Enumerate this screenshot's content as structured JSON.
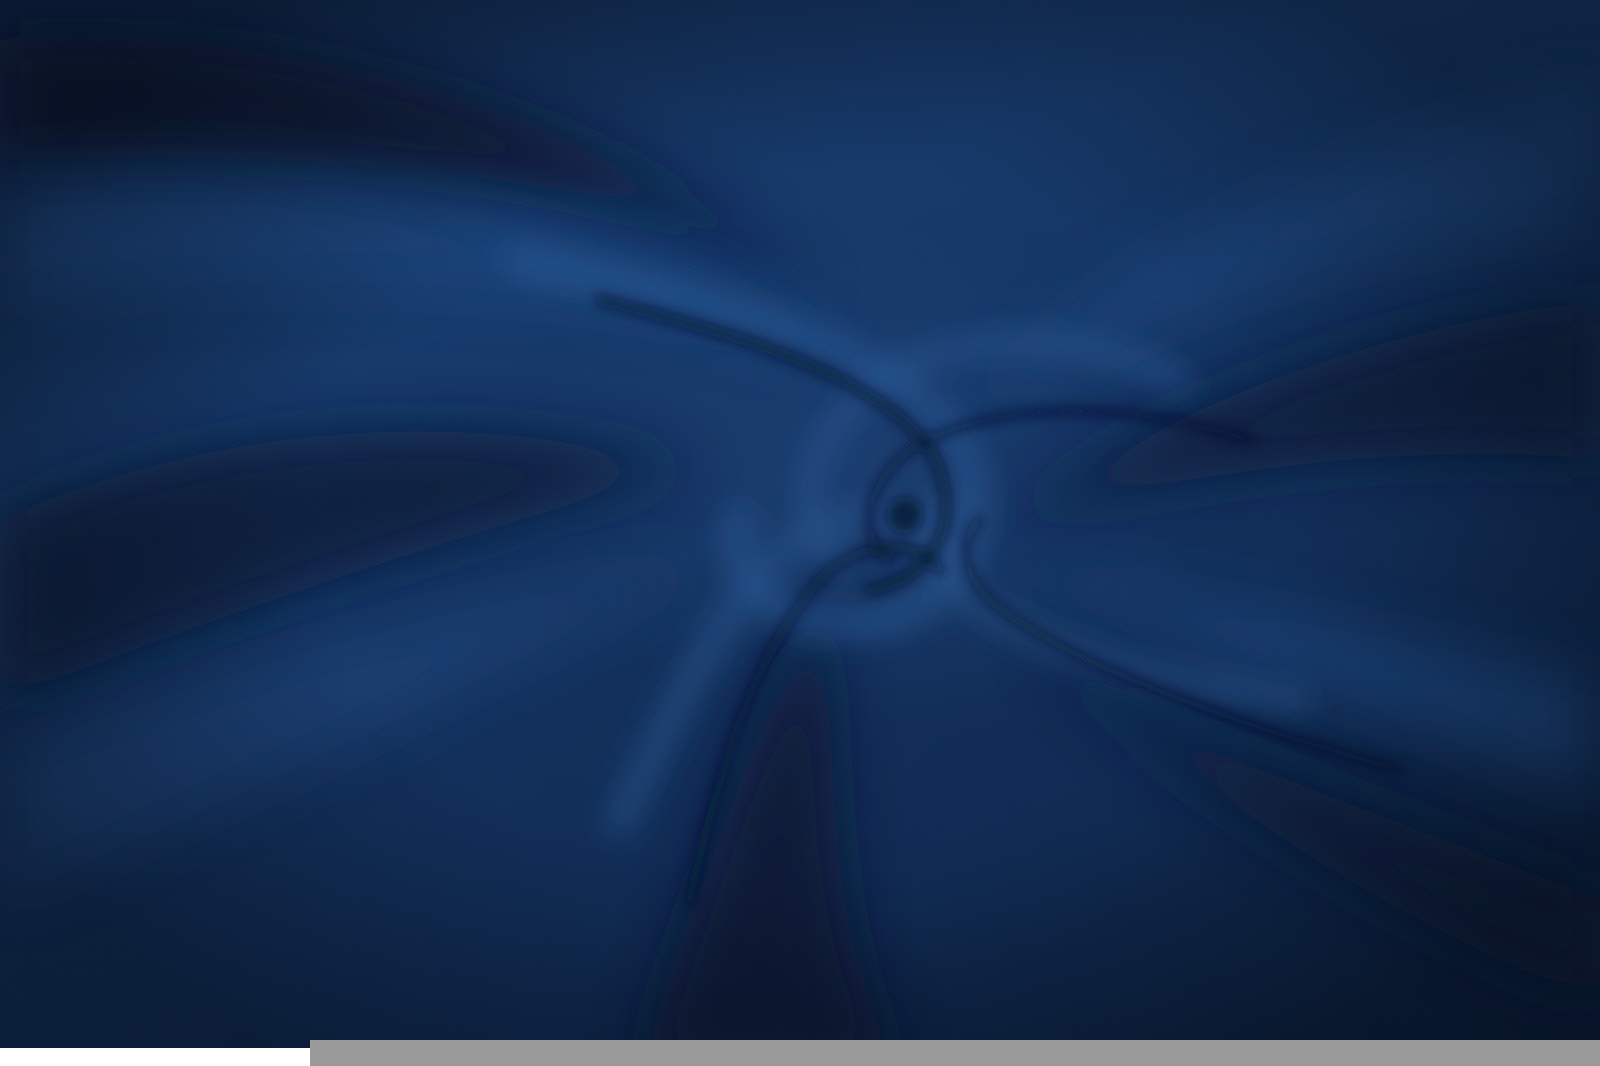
{
  "scene": {
    "subject": "",
    "colors": {
      "base": "#12305c",
      "highlight": "#2a5a98",
      "shadow": "#081830",
      "strip": "#9a9a9a"
    }
  }
}
